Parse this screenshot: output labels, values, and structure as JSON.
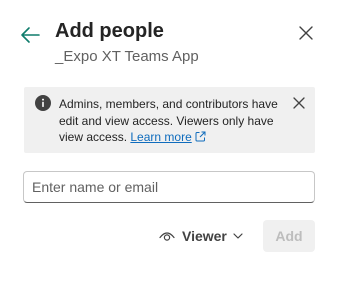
{
  "header": {
    "title": "Add people",
    "subtitle": "_Expo XT Teams App",
    "back_icon": "arrow-left-icon",
    "close_icon": "close-icon"
  },
  "notice": {
    "text": "Admins, members, and contributors have edit and view access. Viewers only have view access.",
    "link_label": "Learn more",
    "info_icon": "info-icon",
    "link_icon": "external-link-icon",
    "dismiss_icon": "close-icon"
  },
  "invite": {
    "placeholder": "Enter name or email",
    "value": ""
  },
  "role": {
    "selected": "Viewer",
    "icon": "eye-icon",
    "chevron": "chevron-down-icon"
  },
  "actions": {
    "add_label": "Add",
    "add_enabled": false
  },
  "colors": {
    "accent": "#0f6cbd",
    "back_arrow": "#0f7c6c",
    "notice_bg": "#f0f0f0",
    "disabled_button_bg": "#f0f0f0",
    "disabled_button_text": "#bdbdbd"
  }
}
